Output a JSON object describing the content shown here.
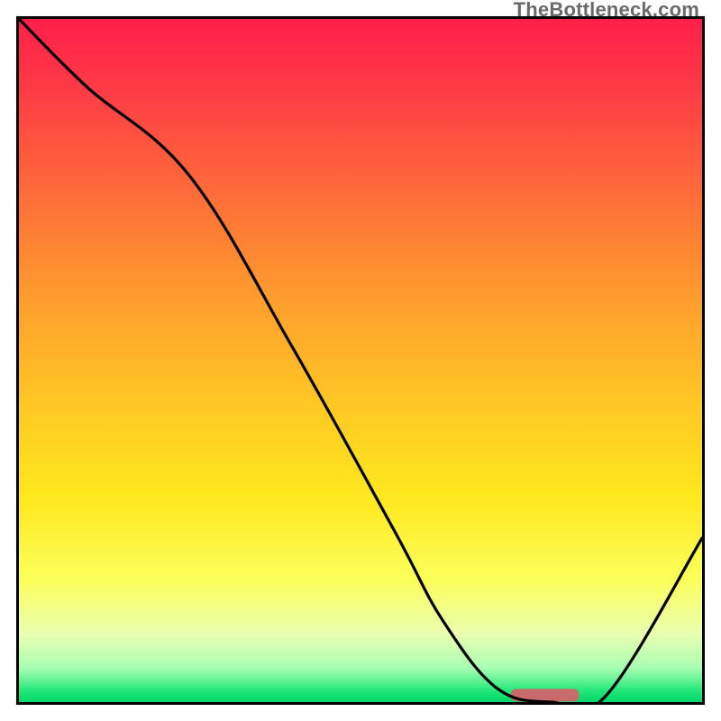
{
  "watermark": "TheBottleneck.com",
  "chart_data": {
    "type": "line",
    "title": "",
    "xlabel": "",
    "ylabel": "",
    "xlim": [
      0,
      100
    ],
    "ylim": [
      0,
      100
    ],
    "series": [
      {
        "name": "curve",
        "x": [
          0,
          10,
          25,
          40,
          55,
          62,
          70,
          78,
          86,
          100
        ],
        "y": [
          100,
          90,
          77,
          52,
          25,
          12,
          2,
          0,
          1,
          24
        ]
      }
    ],
    "marker": {
      "name": "target-bar",
      "x_start": 72,
      "x_end": 82,
      "y": 1,
      "color": "#c96a6d"
    },
    "background_gradient": {
      "stops": [
        {
          "offset": 0.0,
          "color": "#ff1f4a"
        },
        {
          "offset": 0.1,
          "color": "#ff3a46"
        },
        {
          "offset": 0.25,
          "color": "#ff6a3a"
        },
        {
          "offset": 0.4,
          "color": "#ff9a2e"
        },
        {
          "offset": 0.55,
          "color": "#ffc425"
        },
        {
          "offset": 0.7,
          "color": "#ffe81e"
        },
        {
          "offset": 0.82,
          "color": "#fbff5a"
        },
        {
          "offset": 0.9,
          "color": "#eaffb0"
        },
        {
          "offset": 0.95,
          "color": "#a8ffb4"
        },
        {
          "offset": 0.985,
          "color": "#1ee676"
        },
        {
          "offset": 1.0,
          "color": "#00d66a"
        }
      ]
    }
  }
}
